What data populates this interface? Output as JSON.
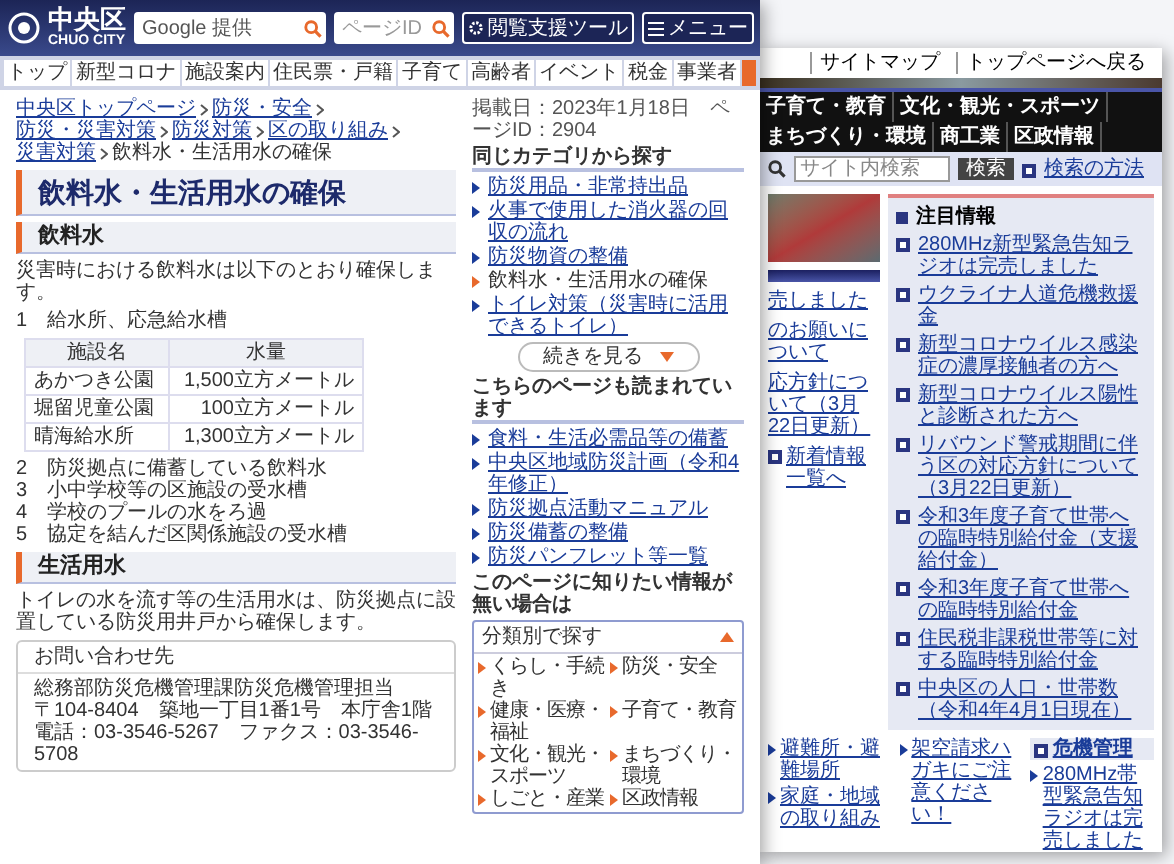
{
  "front_page": {
    "header": {
      "logo": "中央区",
      "logo_sub": "CHUO CITY",
      "search": {
        "placeholder": "Google 提供"
      },
      "page_id": {
        "placeholder": "ページID"
      },
      "support_button": "閲覧支援ツール",
      "menu_button": "メニュー"
    },
    "nav": [
      "トップ",
      "新型コロナ",
      "施設案内",
      "住民票・戸籍",
      "子育て",
      "高齢者",
      "イベント",
      "税金",
      "事業者"
    ],
    "breadcrumb": [
      "中央区トップページ",
      "防災・安全",
      "防災・災害対策",
      "防災対策",
      "区の取り組み",
      "災害対策",
      "飲料水・生活用水の確保"
    ],
    "main": {
      "title": "飲料水・生活用水の確保",
      "section_1": {
        "heading": "飲料水",
        "intro": "災害時における飲料水は以下のとおり確保します。",
        "item": "1　給水所、応急給水槽",
        "table": {
          "columns": [
            "施設名",
            "水量"
          ],
          "rows": [
            [
              "あかつき公園",
              "1,500立方メートル"
            ],
            [
              "堀留児童公園",
              "100立方メートル"
            ],
            [
              "晴海給水所",
              "1,300立方メートル"
            ]
          ]
        },
        "list": [
          "2　防災拠点に備蓄している飲料水",
          "3　小中学校等の区施設の受水槽",
          "4　学校のプールの水をろ過",
          "5　協定を結んだ区関係施設の受水槽"
        ]
      },
      "section_2": {
        "heading": "生活用水",
        "text": "トイレの水を流す等の生活用水は、防災拠点に設置している防災用井戸から確保します。"
      },
      "contact": {
        "heading": "お問い合わせ先",
        "lines": [
          "総務部防災危機管理課防災危機管理担当",
          "〒104-8404　築地一丁目1番1号　本庁舎1階",
          "電話：03-3546-5267　ファクス：03-3546-5708"
        ]
      }
    },
    "sidebar": {
      "meta": "掲載日：2023年1月18日　ページID：2904",
      "same_category": {
        "heading": "同じカテゴリから探す",
        "items": [
          {
            "label": "防災用品・非常持出品",
            "current": false
          },
          {
            "label": "火事で使用した消火器の回収の流れ",
            "current": false
          },
          {
            "label": "防災物資の整備",
            "current": false
          },
          {
            "label": "飲料水・生活用水の確保",
            "current": true
          },
          {
            "label": "トイレ対策（災害時に活用できるトイレ）",
            "current": false
          }
        ],
        "more_button": "続きを見る"
      },
      "also_read": {
        "heading": "こちらのページも読まれています",
        "items": [
          "食料・生活必需品等の備蓄",
          "中央区地域防災計画（令和4年修正）",
          "防災拠点活動マニュアル",
          "防災備蓄の整備",
          "防災パンフレット等一覧"
        ]
      },
      "category_finder": {
        "heading": "このページに知りたい情報が無い場合は",
        "dropdown": {
          "label": "分類別で探す",
          "expanded": true
        },
        "options": [
          "くらし・手続き",
          "防災・安全",
          "健康・医療・福祉",
          "子育て・教育",
          "文化・観光・スポーツ",
          "まちづくり・環境",
          "しごと・産業",
          "区政情報"
        ]
      }
    }
  },
  "back_page": {
    "top_links": [
      "サイトマップ",
      "トップページへ戻る"
    ],
    "nav": [
      "子育て・教育",
      "文化・観光・スポーツ",
      "まちづくり・環境",
      "商工業",
      "区政情報"
    ],
    "search": {
      "placeholder": "サイト内検索",
      "button": "検索",
      "help_link": "検索の方法"
    },
    "news_fragments": [
      "売しました",
      "のお願いについて",
      "応方針について（3月22日更新）"
    ],
    "news_more": "新着情報一覧へ",
    "featured": {
      "heading": "注目情報",
      "items": [
        "280MHz新型緊急告知ラジオは完売しました",
        "ウクライナ人道危機救援金",
        "新型コロナウイルス感染症の濃厚接触者の方へ",
        "新型コロナウイルス陽性と診断された方へ",
        "リバウンド警戒期間に伴う区の対応方針について（3月22日更新）",
        "令和3年度子育て世帯への臨時特別給付金（支援給付金）",
        "令和3年度子育て世帯への臨時特別給付金",
        "住民税非課税世帯等に対する臨時特別給付金",
        "中央区の人口・世帯数（令和4年4月1日現在）"
      ]
    },
    "bottom_columns": [
      {
        "items": [
          "避難所・避難場所",
          "家庭・地域の取り組み"
        ]
      },
      {
        "items": [
          "架空請求ハガキにご注意ください！"
        ]
      },
      {
        "heading": "危機管理",
        "items": [
          "280MHz帯型緊急告知ラジオは完売しました"
        ]
      }
    ]
  }
}
